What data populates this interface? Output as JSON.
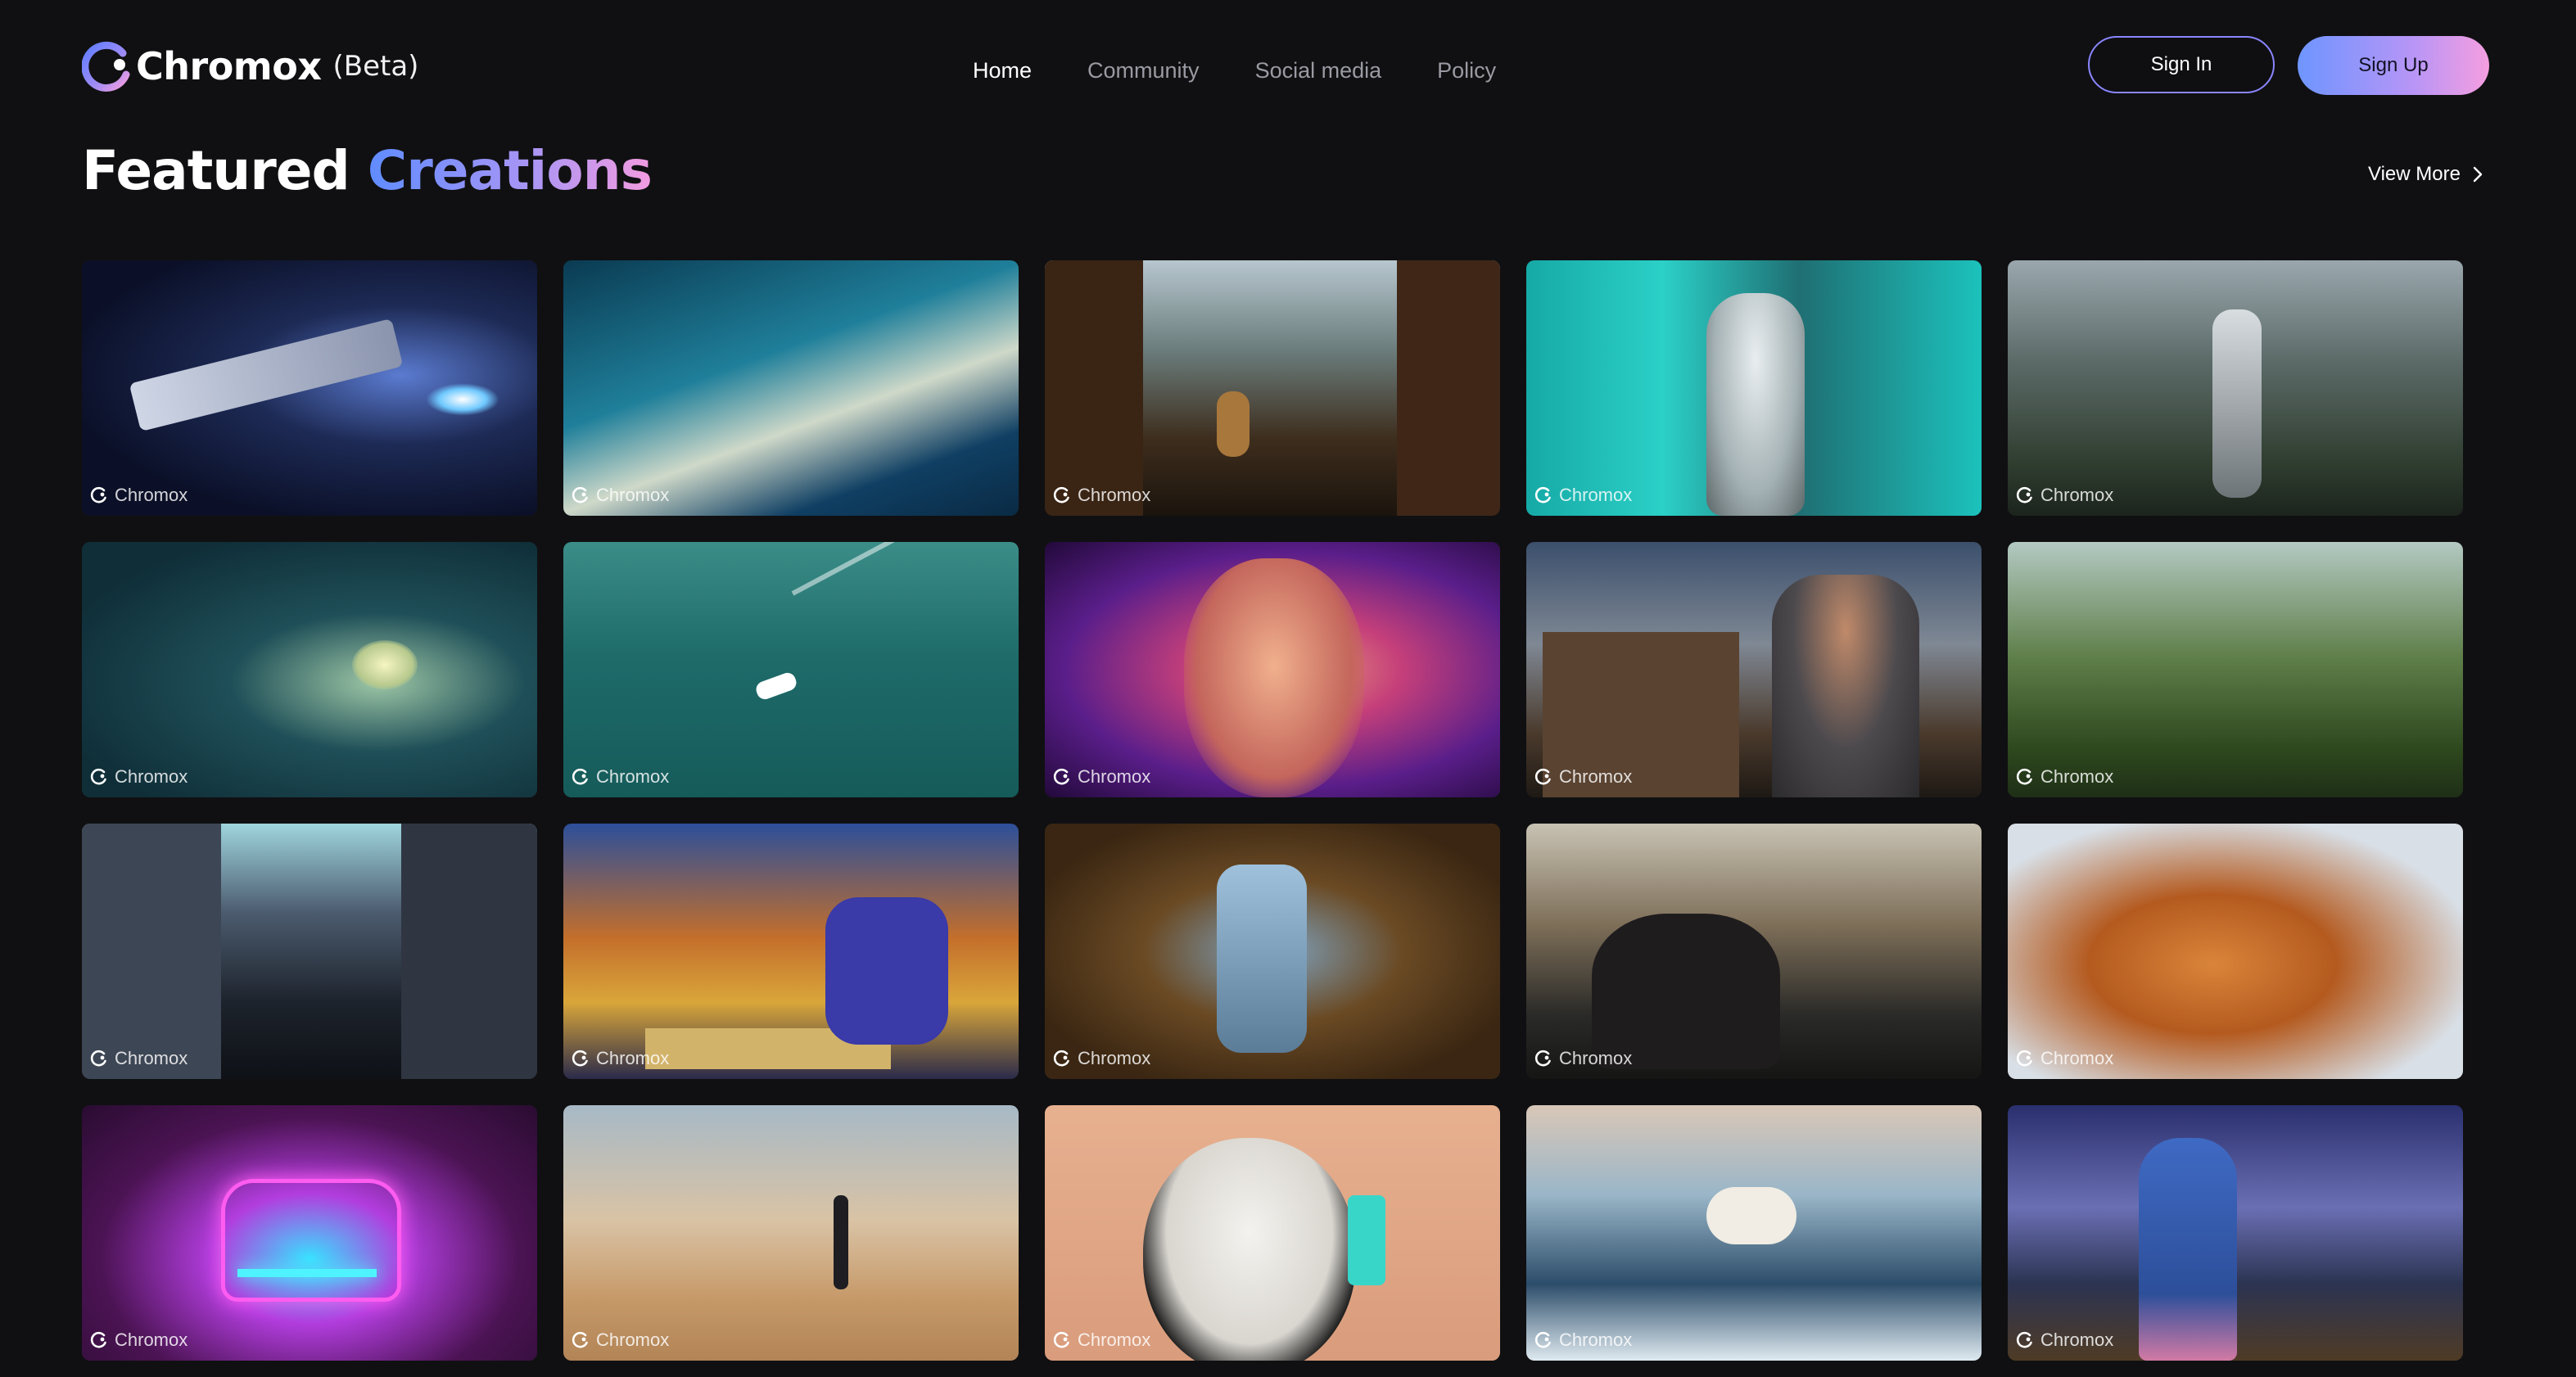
{
  "brand": {
    "name": "Chromox",
    "badge": "(Beta)"
  },
  "nav": [
    {
      "label": "Home",
      "active": true
    },
    {
      "label": "Community",
      "active": false
    },
    {
      "label": "Social media",
      "active": false
    },
    {
      "label": "Policy",
      "active": false
    }
  ],
  "auth": {
    "sign_in": "Sign In",
    "sign_up": "Sign Up"
  },
  "section": {
    "title_plain": "Featured",
    "title_accent": "Creations",
    "view_more": "View More"
  },
  "watermark_label": "Chromox",
  "colors": {
    "background": "#101012",
    "nav_inactive": "#9a9aa3",
    "accent_blue": "#6e95ff",
    "accent_pink": "#f59ee0"
  },
  "gallery": [
    {
      "subject": "spaceship-in-space",
      "watermark": "Chromox"
    },
    {
      "subject": "ocean-wave",
      "watermark": "Chromox"
    },
    {
      "subject": "robot-in-junk-town",
      "watermark": "Chromox"
    },
    {
      "subject": "astronaut-teal",
      "watermark": "Chromox"
    },
    {
      "subject": "robot-in-ruins",
      "watermark": "Chromox"
    },
    {
      "subject": "jellyfish-underwater",
      "watermark": "Chromox"
    },
    {
      "subject": "speedboat-at-sea",
      "watermark": "Chromox"
    },
    {
      "subject": "warrior-woman-portrait",
      "watermark": "Chromox"
    },
    {
      "subject": "knight-and-castle",
      "watermark": "Chromox"
    },
    {
      "subject": "mossy-forest",
      "watermark": "Chromox"
    },
    {
      "subject": "comic-city-street",
      "watermark": "Chromox"
    },
    {
      "subject": "painting-two-men-at-table",
      "watermark": "Chromox"
    },
    {
      "subject": "tin-robot-village",
      "watermark": "Chromox"
    },
    {
      "subject": "rider-on-horse",
      "watermark": "Chromox"
    },
    {
      "subject": "orange-cat",
      "watermark": "Chromox"
    },
    {
      "subject": "neon-car",
      "watermark": "Chromox"
    },
    {
      "subject": "man-in-desert",
      "watermark": "Chromox"
    },
    {
      "subject": "panda-with-phone",
      "watermark": "Chromox"
    },
    {
      "subject": "polar-bear-on-ice",
      "watermark": "Chromox"
    },
    {
      "subject": "child-under-stars",
      "watermark": "Chromox"
    }
  ]
}
